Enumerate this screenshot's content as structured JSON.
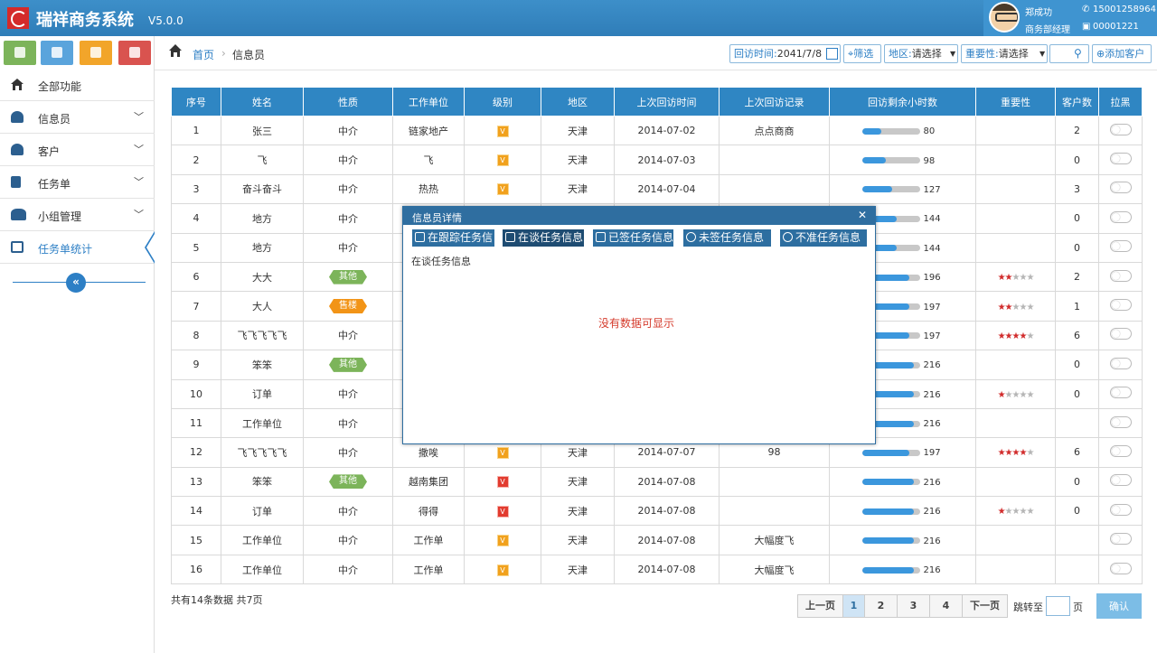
{
  "app": {
    "title": "瑞祥商务系统",
    "version": "V5.0.0"
  },
  "user": {
    "name": "郑成功",
    "phone": "15001258964",
    "role": "商务部经理",
    "ext": "00001221"
  },
  "nav": {
    "items": [
      {
        "label": "全部功能",
        "icon": "home-icon",
        "chevron": ""
      },
      {
        "label": "信息员",
        "icon": "person-icon",
        "chevron": "﹀"
      },
      {
        "label": "客户",
        "icon": "person-icon",
        "chevron": "﹀"
      },
      {
        "label": "任务单",
        "icon": "document-icon",
        "chevron": "﹀"
      },
      {
        "label": "小组管理",
        "icon": "group-icon",
        "chevron": "﹀"
      },
      {
        "label": "任务单统计",
        "icon": "chart-icon",
        "chevron": ""
      }
    ]
  },
  "breadcrumb": {
    "home": "首页",
    "sep": "›",
    "current": "信息员"
  },
  "filters": {
    "date_label": "回访时间:",
    "date_value": "2041/7/8",
    "screen_label": "筛选",
    "region_label": "地区:",
    "region_value": "请选择",
    "importance_label": "重要性:",
    "importance_value": "请选择",
    "add_label": "添加客户"
  },
  "table": {
    "headers": [
      "序号",
      "姓名",
      "性质",
      "工作单位",
      "级别",
      "地区",
      "上次回访时间",
      "上次回访记录",
      "回访剩余小时数",
      "重要性",
      "客户数",
      "拉黑"
    ],
    "rows": [
      {
        "no": "1",
        "name": "张三",
        "type": "中介",
        "badge": "",
        "company": "链家地产",
        "lvl": "y",
        "region": "天津",
        "date": "2014-07-02",
        "record": "点点商商",
        "hours": 80,
        "stars": 0,
        "clients": "2"
      },
      {
        "no": "2",
        "name": "飞",
        "type": "中介",
        "badge": "",
        "company": "飞",
        "lvl": "y",
        "region": "天津",
        "date": "2014-07-03",
        "record": "",
        "hours": 98,
        "stars": 0,
        "clients": "0"
      },
      {
        "no": "3",
        "name": "奋斗奋斗",
        "type": "中介",
        "badge": "",
        "company": "热热",
        "lvl": "y",
        "region": "天津",
        "date": "2014-07-04",
        "record": "",
        "hours": 127,
        "stars": 0,
        "clients": "3"
      },
      {
        "no": "4",
        "name": "地方",
        "type": "中介",
        "badge": "",
        "company": "",
        "lvl": "",
        "region": "",
        "date": "",
        "record": "",
        "hours": 144,
        "stars": 0,
        "clients": "0"
      },
      {
        "no": "5",
        "name": "地方",
        "type": "中介",
        "badge": "",
        "company": "",
        "lvl": "",
        "region": "",
        "date": "",
        "record": "",
        "hours": 144,
        "stars": 0,
        "clients": "0"
      },
      {
        "no": "6",
        "name": "大大",
        "type": "其他",
        "badge": "green",
        "company": "",
        "lvl": "",
        "region": "",
        "date": "",
        "record": "",
        "hours": 196,
        "stars": 2,
        "clients": "2"
      },
      {
        "no": "7",
        "name": "大人",
        "type": "售楼",
        "badge": "orange",
        "company": "",
        "lvl": "",
        "region": "",
        "date": "",
        "record": "",
        "hours": 197,
        "stars": 2,
        "clients": "1"
      },
      {
        "no": "8",
        "name": "飞飞飞飞飞",
        "type": "中介",
        "badge": "",
        "company": "",
        "lvl": "",
        "region": "",
        "date": "",
        "record": "",
        "hours": 197,
        "stars": 4,
        "clients": "6"
      },
      {
        "no": "9",
        "name": "笨笨",
        "type": "其他",
        "badge": "green",
        "company": "",
        "lvl": "",
        "region": "",
        "date": "",
        "record": "",
        "hours": 216,
        "stars": 0,
        "clients": "0"
      },
      {
        "no": "10",
        "name": "订单",
        "type": "中介",
        "badge": "",
        "company": "",
        "lvl": "",
        "region": "",
        "date": "",
        "record": "",
        "hours": 216,
        "stars": 1,
        "clients": "0"
      },
      {
        "no": "11",
        "name": "工作单位",
        "type": "中介",
        "badge": "",
        "company": "",
        "lvl": "",
        "region": "",
        "date": "",
        "record": "",
        "hours": 216,
        "stars": 0,
        "clients": ""
      },
      {
        "no": "12",
        "name": "飞飞飞飞飞",
        "type": "中介",
        "badge": "",
        "company": "撒唉",
        "lvl": "y",
        "region": "天津",
        "date": "2014-07-07",
        "record": "98",
        "hours": 197,
        "stars": 4,
        "clients": "6"
      },
      {
        "no": "13",
        "name": "笨笨",
        "type": "其他",
        "badge": "green",
        "company": "越南集团",
        "lvl": "r",
        "region": "天津",
        "date": "2014-07-08",
        "record": "",
        "hours": 216,
        "stars": 0,
        "clients": "0"
      },
      {
        "no": "14",
        "name": "订单",
        "type": "中介",
        "badge": "",
        "company": "得得",
        "lvl": "r",
        "region": "天津",
        "date": "2014-07-08",
        "record": "",
        "hours": 216,
        "stars": 1,
        "clients": "0"
      },
      {
        "no": "15",
        "name": "工作单位",
        "type": "中介",
        "badge": "",
        "company": "工作单",
        "lvl": "y",
        "region": "天津",
        "date": "2014-07-08",
        "record": "大幅度飞",
        "hours": 216,
        "stars": 0,
        "clients": ""
      },
      {
        "no": "16",
        "name": "工作单位",
        "type": "中介",
        "badge": "",
        "company": "工作单",
        "lvl": "y",
        "region": "天津",
        "date": "2014-07-08",
        "record": "大幅度飞",
        "hours": 216,
        "stars": 0,
        "clients": ""
      }
    ]
  },
  "footer": {
    "summary": "共有14条数据  共7页"
  },
  "pager": {
    "prev": "上一页",
    "pages": [
      "1",
      "2",
      "3",
      "4"
    ],
    "current": "1",
    "next": "下一页",
    "jump_label": "跳转至",
    "jump_suffix": "页",
    "confirm": "确认"
  },
  "modal": {
    "title": "信息员详情",
    "close": "✕",
    "tabs": [
      "在跟踪任务信",
      "在谈任务信息",
      "已签任务信息",
      "未签任务信息",
      "不准任务信息"
    ],
    "active_tab": 1,
    "subtitle": "在谈任务信息",
    "empty": "没有数据可显示"
  },
  "colors": {
    "primary": "#2f86c3",
    "header": "#3583be",
    "badge_green": "#7cb45a",
    "badge_orange": "#f29417",
    "star_red": "#d12b2b"
  }
}
